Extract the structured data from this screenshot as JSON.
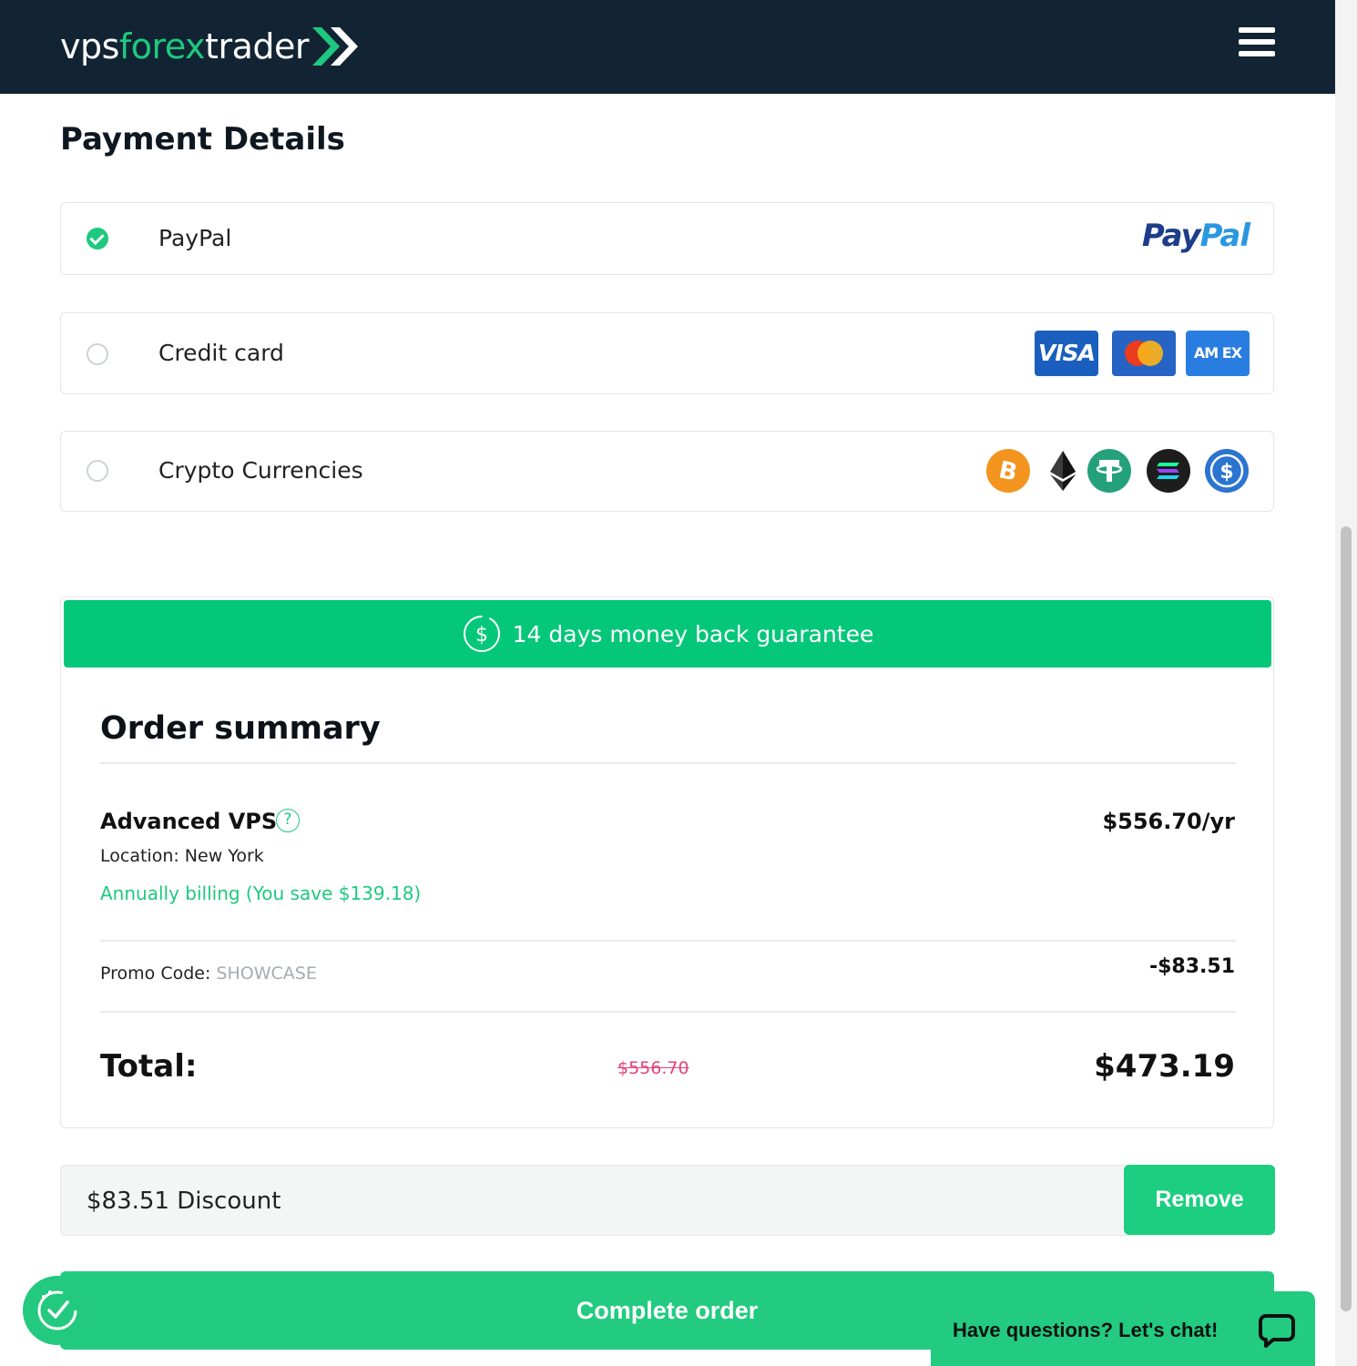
{
  "header": {
    "logo_part1": "vps",
    "logo_part2": "forex",
    "logo_part3": "trader",
    "menu_icon": "hamburger-menu-icon"
  },
  "page_title": "Payment Details",
  "payment_options": [
    {
      "label": "PayPal",
      "selected": true,
      "brand": "PayPal",
      "brand_part1": "Pay",
      "brand_part2": "Pal"
    },
    {
      "label": "Credit card",
      "selected": false,
      "logos": [
        "VISA",
        "mastercard",
        "AMEX"
      ],
      "visa_text": "VISA",
      "amex_text": "AM EX"
    },
    {
      "label": "Crypto Currencies",
      "selected": false,
      "icons": [
        "bitcoin-icon",
        "ethereum-icon",
        "tether-icon",
        "solana-icon",
        "usdc-icon"
      ]
    }
  ],
  "guarantee": {
    "text": "14 days money back guarantee",
    "icon": "dollar-coin-icon"
  },
  "order_summary": {
    "title": "Order summary",
    "product": {
      "name": "Advanced VPS",
      "help": "?",
      "price": "$556.70/yr",
      "location": "Location: New York",
      "billing": "Annually billing (You save $139.18)"
    },
    "promo": {
      "label": "Promo Code: ",
      "code": "SHOWCASE",
      "amount": "-$83.51"
    },
    "total": {
      "label": "Total:",
      "original": "$556.70",
      "final": "$473.19"
    }
  },
  "discount": {
    "text": "$83.51 Discount",
    "remove_label": "Remove"
  },
  "complete_order_label": "Complete order",
  "chat": {
    "text": "Have questions? Let's chat!"
  },
  "colors": {
    "brand_green": "#1ec97f",
    "header_bg": "#122433",
    "strike_red": "#e0457a"
  }
}
